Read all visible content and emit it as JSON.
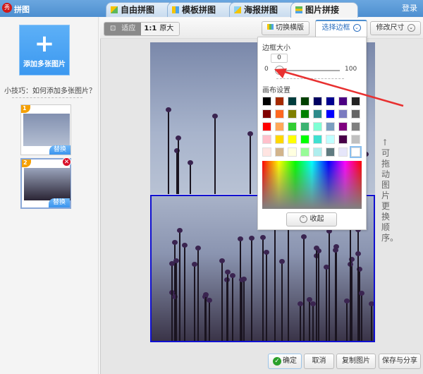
{
  "app": {
    "title": "拼图",
    "logo_text": "秀",
    "login": "登录"
  },
  "tabs": [
    {
      "label": "自由拼图",
      "icon": "free-collage-icon"
    },
    {
      "label": "模板拼图",
      "icon": "template-icon"
    },
    {
      "label": "海报拼图",
      "icon": "poster-icon"
    },
    {
      "label": "图片拼接",
      "icon": "stitch-icon",
      "active": true
    }
  ],
  "sidebar": {
    "add_button": "添加多张图片",
    "tip": "小技巧：如何添加多张图片？",
    "thumbs": [
      {
        "index": "1",
        "replace": "替换"
      },
      {
        "index": "2",
        "replace": "替换",
        "close": "✕"
      }
    ]
  },
  "toolbar": {
    "fit": "适应",
    "actual": "原大",
    "actual_prefix": "1:1",
    "switch_layout": "切换横版",
    "select_border": "选择边框",
    "resize": "修改尺寸"
  },
  "border_panel": {
    "size_label": "边框大小",
    "size_value": "0",
    "min": "0",
    "max": "100",
    "canvas_label": "画布设置",
    "collapse": "收起",
    "selected_color": "#ffffff",
    "colors": [
      "#000000",
      "#a52a00",
      "#003c3c",
      "#004000",
      "#000060",
      "#000090",
      "#4b0082",
      "#222222",
      "#800000",
      "#ff6820",
      "#808000",
      "#008000",
      "#2e8b8b",
      "#0000ff",
      "#7b7bc0",
      "#666666",
      "#ff0000",
      "#ffa858",
      "#32cd32",
      "#3cb371",
      "#7fffd4",
      "#7b9ec0",
      "#800080",
      "#808080",
      "#ffc0cb",
      "#ffd700",
      "#ffff00",
      "#00ff00",
      "#40e0d0",
      "#c0ffff",
      "#480048",
      "#c0c0c0",
      "#ffe4e1",
      "#d2b48c",
      "#ffffe0",
      "#98fb98",
      "#afeeee",
      "#607b80",
      "#e6e6fa",
      "#ffffff"
    ]
  },
  "annotation": "↑可拖动图片更换顺序。",
  "footer": {
    "confirm": "确定",
    "cancel": "取消",
    "copy": "复制图片",
    "save_share": "保存与分享"
  }
}
